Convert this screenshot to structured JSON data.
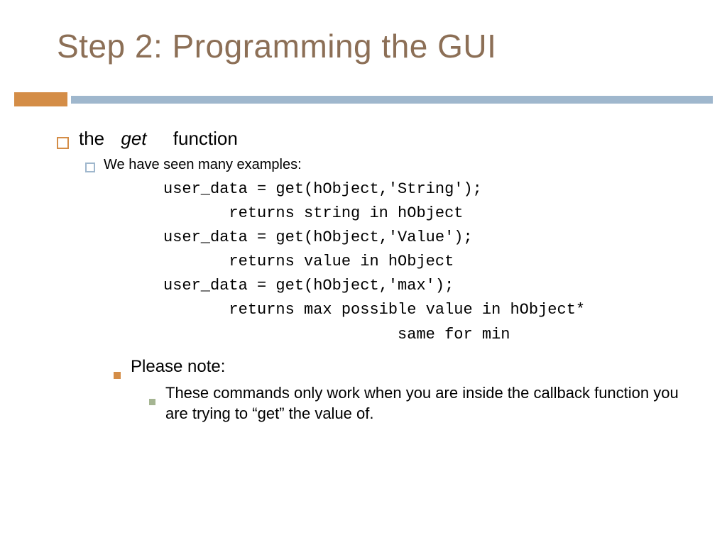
{
  "title": "Step 2: Programming the GUI",
  "bullet1": {
    "pre": "the",
    "em": "get",
    "post": "function"
  },
  "bullet2": "We have seen many examples:",
  "code": {
    "l1": "user_data = get(hObject,'String');",
    "l2": "       returns string in hObject",
    "l3": "user_data = get(hObject,'Value');",
    "l4": "       returns value in hObject",
    "l5": "user_data = get(hObject,'max');",
    "l6": "       returns max possible value in hObject*",
    "l7": "                         same for min"
  },
  "note_title": "Please note:",
  "note_body": "These commands only work when you are inside the callback function you are trying to “get” the value of."
}
